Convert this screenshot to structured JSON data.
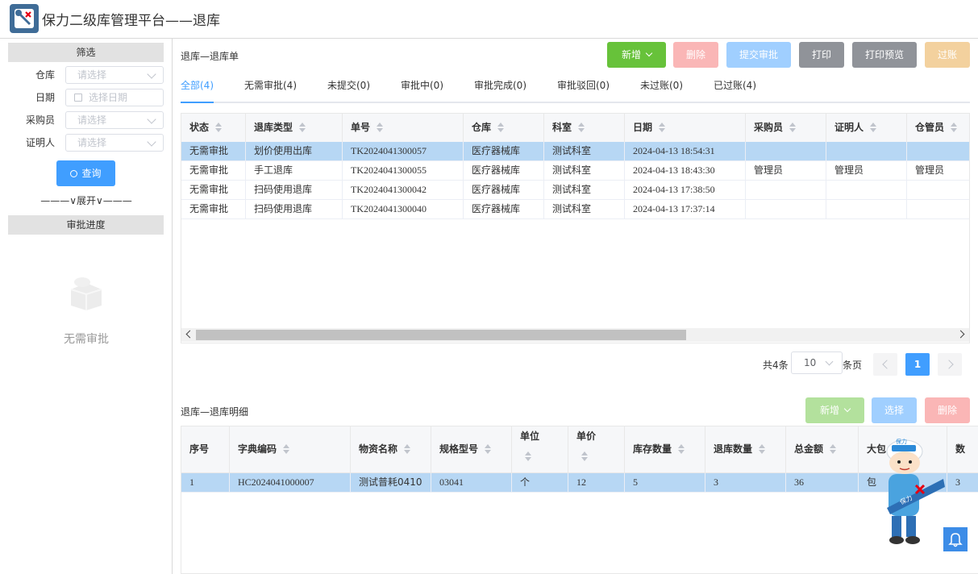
{
  "header": {
    "title": "保力二级库管理平台——退库"
  },
  "sidebar": {
    "filter_title": "筛选",
    "filters": [
      {
        "label": "仓库",
        "placeholder": "请选择"
      },
      {
        "label": "日期",
        "placeholder": "选择日期"
      },
      {
        "label": "采购员",
        "placeholder": "请选择"
      },
      {
        "label": "证明人",
        "placeholder": "请选择"
      }
    ],
    "query_label": "查询",
    "expand_label": "———∨展开∨———",
    "progress_title": "审批进度",
    "empty_text": "无需审批"
  },
  "main": {
    "title": "退库—退库单",
    "toolbar": {
      "add": "新增",
      "delete": "删除",
      "submit": "提交审批",
      "print": "打印",
      "preview": "打印预览",
      "post": "过账"
    },
    "tabs": [
      "全部(4)",
      "无需审批(4)",
      "未提交(0)",
      "审批中(0)",
      "审批完成(0)",
      "审批驳回(0)",
      "未过账(0)",
      "已过账(4)"
    ],
    "table": {
      "columns": [
        "状态",
        "退库类型",
        "单号",
        "仓库",
        "科室",
        "日期",
        "采购员",
        "证明人",
        "仓管员"
      ],
      "rows": [
        [
          "无需审批",
          "划价使用出库",
          "TK2024041300057",
          "医疗器械库",
          "测试科室",
          "2024-04-13 18:54:31",
          "",
          "",
          ""
        ],
        [
          "无需审批",
          "手工退库",
          "TK2024041300055",
          "医疗器械库",
          "测试科室",
          "2024-04-13 18:43:30",
          "管理员",
          "管理员",
          "管理员"
        ],
        [
          "无需审批",
          "扫码使用退库",
          "TK2024041300042",
          "医疗器械库",
          "测试科室",
          "2024-04-13 17:38:50",
          "",
          "",
          ""
        ],
        [
          "无需审批",
          "扫码使用退库",
          "TK2024041300040",
          "医疗器械库",
          "测试科室",
          "2024-04-13 17:37:14",
          "",
          "",
          ""
        ]
      ]
    },
    "pager": {
      "total": "共4条",
      "size": "10",
      "unit": "条页",
      "current": "1"
    }
  },
  "detail": {
    "title": "退库—退库明细",
    "toolbar": {
      "add": "新增",
      "select": "选择",
      "delete": "删除"
    },
    "table": {
      "columns": [
        "序号",
        "字典编码",
        "物资名称",
        "规格型号",
        "单位",
        "单价",
        "库存数量",
        "退库数量",
        "总金额",
        "大包",
        "数"
      ],
      "rows": [
        [
          "1",
          "HC2024041000007",
          "测试普耗0410",
          "03041",
          "个",
          "12",
          "5",
          "3",
          "36",
          "包",
          "3"
        ]
      ]
    }
  },
  "mascot": {
    "badge": "保力",
    "sash": "保力"
  },
  "colors": {
    "primary": "#409eff",
    "green": "#67c23a",
    "green_disabled": "#b3e19d",
    "red_disabled": "#fab6b6",
    "blue_disabled": "#a0cfff",
    "gray": "#909399",
    "orange_disabled": "#f3d19e",
    "selected_row": "#b7d7f4"
  }
}
